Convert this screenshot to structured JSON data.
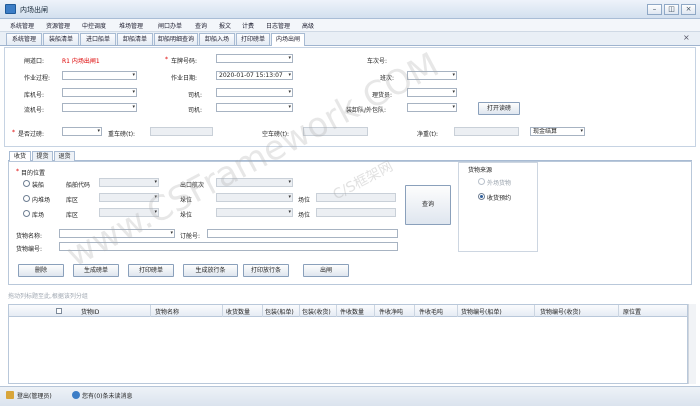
{
  "window": {
    "title": "内场出闸",
    "min": "–",
    "restore": "◫",
    "close": "×"
  },
  "menu": [
    "系统管理",
    "资源管理",
    "中控调度",
    "堆场管理",
    "闸口办单",
    "查询",
    "报文",
    "计费",
    "日志管理",
    "高级"
  ],
  "tabs": [
    "系统管理",
    "装船清单",
    "进口船单",
    "卸船清单",
    "卸船明细查询",
    "卸船入场",
    "打印磅单",
    "内场出闸"
  ],
  "active_tab": 7,
  "tab_close": "×",
  "form": {
    "gate_label": "闸道口:",
    "gate_value": "R1 内场出闸1",
    "truck_label": "车牌号码:",
    "truck_value": "",
    "trip_label": "车次号:",
    "process_label": "作业过程:",
    "process_value": "",
    "date_label": "作业日期:",
    "date_value": "2020-01-07 15:13:07",
    "shift_label": "班次:",
    "yard_crane_label": "库机号:",
    "driver_label": "司机:",
    "clerk_label": "理货员:",
    "flow_crane_label": "流机号:",
    "driver2_label": "司机:",
    "loading_team_label": "装卸队/外包队:",
    "print_button": "打开读磅",
    "weigh_label": "是否过磅:",
    "gross_label": "重车磅(t):",
    "empty_label": "空车磅(t):",
    "net_label": "净重(t):",
    "settle_value": "现金结算"
  },
  "subtabs": [
    "收货",
    "提货",
    "退货"
  ],
  "active_subtab": 0,
  "receive": {
    "dest_label": "目的位置",
    "radio_ship": "装船",
    "radio_yard": "内堆场",
    "radio_warehouse": "库场",
    "ship_code_label": "船舶代码",
    "out_voyage_label": "出口航次",
    "storage1_label": "库区",
    "bay1_label": "垛位",
    "spot1_label": "场位",
    "storage2_label": "库区",
    "bay2_label": "垛位",
    "spot2_label": "场位",
    "query_button": "查询",
    "goods_name_label": "货物名称:",
    "order_no_label": "订舱号:",
    "goods_no_label": "货物编号:",
    "source_title": "货物来源",
    "source_external": "外场货物",
    "source_booking": "收货预约"
  },
  "actions": [
    "删除",
    "生成磅单",
    "打印磅单",
    "生成放行条",
    "打印放行条",
    "出闸"
  ],
  "grid_hint": "拖动列标题至此,根据该列分组",
  "grid_columns": [
    "货物ID",
    "货物名称",
    "收货数量",
    "包装(船单)",
    "包装(收货)",
    "件收数量",
    "件收净吨",
    "件收毛吨",
    "货物编号(船单)",
    "货物编号(收货)",
    "原位置"
  ],
  "status": {
    "user": "登出(管理员)",
    "notice": "您有(0)条未读消息"
  },
  "watermark": "www.CSFramework.COM",
  "watermark_sub": "C/S框架网"
}
